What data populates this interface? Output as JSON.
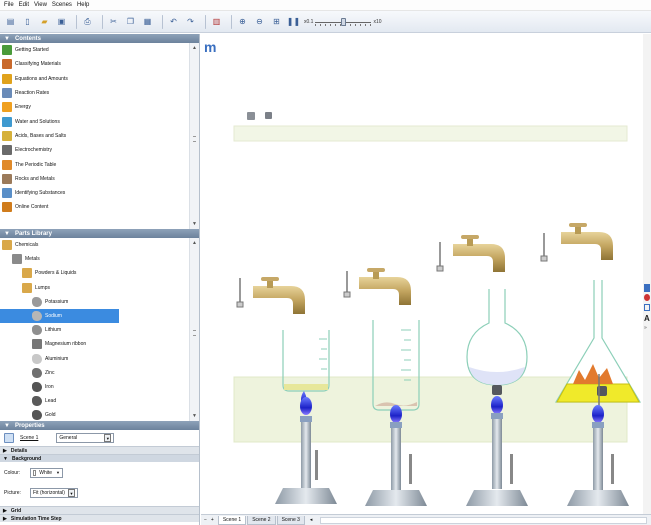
{
  "menu": [
    "File",
    "Edit",
    "View",
    "Scenes",
    "Help"
  ],
  "toolbar": {
    "zoom_min": "x0.1",
    "zoom_max": "x10",
    "zoom_value": 0.5
  },
  "contents": {
    "title": "Contents",
    "items": [
      {
        "label": "Getting Started",
        "icon": "getting-started-icon",
        "color": "#4a9b3a"
      },
      {
        "label": "Classifying Materials",
        "icon": "materials-icon",
        "color": "#c9692b"
      },
      {
        "label": "Equations and Amounts",
        "icon": "equations-icon",
        "color": "#e0a21c"
      },
      {
        "label": "Reaction Rates",
        "icon": "graph-icon",
        "color": "#6a8bb8"
      },
      {
        "label": "Energy",
        "icon": "energy-icon",
        "color": "#f0a020"
      },
      {
        "label": "Water and Solutions",
        "icon": "water-icon",
        "color": "#3f9ad0"
      },
      {
        "label": "Acids, Bases and Salts",
        "icon": "acids-icon",
        "color": "#d6b13a"
      },
      {
        "label": "Electrochemistry",
        "icon": "battery-icon",
        "color": "#6a6a6a"
      },
      {
        "label": "The Periodic Table",
        "icon": "periodic-table-icon",
        "color": "#e08a2a"
      },
      {
        "label": "Rocks and Metals",
        "icon": "rocks-icon",
        "color": "#9b7a5a"
      },
      {
        "label": "Identifying Substances",
        "icon": "magnifier-icon",
        "color": "#5a8fc8"
      },
      {
        "label": "Online Content",
        "icon": "globe-icon",
        "color": "#d07c1c"
      }
    ]
  },
  "parts": {
    "title": "Parts Library",
    "items": [
      {
        "label": "Chemicals",
        "indent": 0,
        "icon": "folder-icon",
        "color": "#d9a84a"
      },
      {
        "label": "Metals",
        "indent": 1,
        "icon": "metals-icon",
        "color": "#8a8a8a"
      },
      {
        "label": "Powders & Liquids",
        "indent": 2,
        "icon": "folder-icon",
        "color": "#d9a84a"
      },
      {
        "label": "Lumps",
        "indent": 2,
        "icon": "folder-icon",
        "color": "#d9a84a"
      },
      {
        "label": "Potassium",
        "indent": 3,
        "icon": "lump-icon",
        "color": "#9a9a9a"
      },
      {
        "label": "Sodium",
        "indent": 3,
        "icon": "lump-icon",
        "color": "#b6b6b6",
        "selected": true
      },
      {
        "label": "Lithium",
        "indent": 3,
        "icon": "lump-icon",
        "color": "#8f8f8f"
      },
      {
        "label": "Magnesium ribbon",
        "indent": 3,
        "icon": "ribbon-icon",
        "color": "#777"
      },
      {
        "label": "Aluminium",
        "indent": 3,
        "icon": "lump-icon",
        "color": "#c8c8c8"
      },
      {
        "label": "Zinc",
        "indent": 3,
        "icon": "lump-icon",
        "color": "#707070"
      },
      {
        "label": "Iron",
        "indent": 3,
        "icon": "lump-icon",
        "color": "#555"
      },
      {
        "label": "Lead",
        "indent": 3,
        "icon": "lump-icon",
        "color": "#5a5a5a"
      },
      {
        "label": "Gold",
        "indent": 3,
        "icon": "lump-icon",
        "color": "#555"
      }
    ]
  },
  "properties": {
    "title": "Properties",
    "scene_link": "Scene 1",
    "mode": "General",
    "sections": {
      "details": "Details",
      "background": "Background",
      "grid": "Grid",
      "sim": "Simulation Time Step"
    },
    "colour_label": "Colour:",
    "colour_value": "White",
    "picture_label": "Picture:",
    "picture_value": "Fit (horizontal)"
  },
  "tabs": [
    "Scene 1",
    "Scene 2",
    "Scene 3"
  ],
  "tabs_controls": [
    "−",
    "+"
  ],
  "canvas": {
    "logo": "m"
  },
  "colors": {
    "accent": "#3b8be0",
    "header": "#7b90a9",
    "tap": "#b89b55",
    "flame": "#2b3ad6"
  }
}
